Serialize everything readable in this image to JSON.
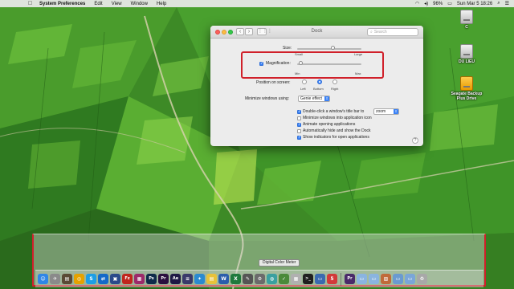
{
  "menubar": {
    "apple": "",
    "app_name": "System Preferences",
    "items": [
      "Edit",
      "View",
      "Window",
      "Help"
    ],
    "battery": "96%",
    "datetime": "Sun Mar 5  18:26"
  },
  "desktop": {
    "icons": [
      {
        "label": "C"
      },
      {
        "label": "DU LIEU"
      },
      {
        "label": "Seagate Backup Plus Drive"
      }
    ]
  },
  "window": {
    "title": "Dock",
    "search_placeholder": "Search",
    "size_label": "Size:",
    "size_small": "Small",
    "size_large": "Large",
    "size_value": 0.55,
    "magnification_label": "Magnification:",
    "magnification_checked": true,
    "mag_min": "Min",
    "mag_max": "Max",
    "magnification_value": 0.05,
    "position_label": "Position on screen:",
    "position_options": [
      "Left",
      "Bottom",
      "Right"
    ],
    "position_selected": "Bottom",
    "minimize_label": "Minimize windows using:",
    "minimize_value": "Genie effect",
    "doubleclick_label": "Double-click a window's title bar to",
    "doubleclick_value": "zoom",
    "doubleclick_checked": true,
    "minimize_into_icon": "Minimize windows into application icon",
    "minimize_into_icon_checked": false,
    "animate_label": "Animate opening applications",
    "animate_checked": true,
    "autohide_label": "Automatically hide and show the Dock",
    "autohide_checked": false,
    "indicators_label": "Show indicators for open applications",
    "indicators_checked": true,
    "help": "?"
  },
  "tooltip": "Digital Color Meter",
  "dock": {
    "apps": [
      {
        "name": "finder-icon",
        "glyph": "☺",
        "color": "#2f86e6"
      },
      {
        "name": "launchpad-icon",
        "glyph": "✈",
        "color": "#8a8a8a"
      },
      {
        "name": "photo-icon",
        "glyph": "▤",
        "color": "#5a4a36"
      },
      {
        "name": "chrome-icon",
        "glyph": "◎",
        "color": "#e5a200"
      },
      {
        "name": "skype-icon",
        "glyph": "S",
        "color": "#1d9ee6"
      },
      {
        "name": "teamviewer-icon",
        "glyph": "⇄",
        "color": "#1469c8"
      },
      {
        "name": "virtualbox-icon",
        "glyph": "▣",
        "color": "#2b4a8a"
      },
      {
        "name": "filezilla-icon",
        "glyph": "Fz",
        "color": "#c0261d"
      },
      {
        "name": "app-icon",
        "glyph": "▦",
        "color": "#9c2a6a"
      },
      {
        "name": "photoshop-icon",
        "glyph": "Ps",
        "color": "#0f2a4a"
      },
      {
        "name": "premiere-icon",
        "glyph": "Pr",
        "color": "#2a0f3f"
      },
      {
        "name": "after-effects-icon",
        "glyph": "Ae",
        "color": "#1f1845"
      },
      {
        "name": "app-icon",
        "glyph": "≡",
        "color": "#3a3a6a"
      },
      {
        "name": "safari-icon",
        "glyph": "✦",
        "color": "#2b8ad0"
      },
      {
        "name": "notes-icon",
        "glyph": "▤",
        "color": "#e8c23a"
      },
      {
        "name": "word-icon",
        "glyph": "W",
        "color": "#2b5dab"
      },
      {
        "name": "excel-icon",
        "glyph": "X",
        "color": "#1f7a3d"
      },
      {
        "name": "app-icon",
        "glyph": "✎",
        "color": "#555555"
      },
      {
        "name": "system-preferences-icon",
        "glyph": "⚙",
        "color": "#6b6b6b"
      },
      {
        "name": "app-icon",
        "glyph": "◍",
        "color": "#3aa0a0"
      },
      {
        "name": "app-icon",
        "glyph": "✓",
        "color": "#4a8a3a"
      },
      {
        "name": "calendar-icon",
        "glyph": "▦",
        "color": "#b0b0b0"
      },
      {
        "name": "terminal-icon",
        "glyph": ">_",
        "color": "#202020"
      },
      {
        "name": "app-icon",
        "glyph": "▭",
        "color": "#3a6ab0"
      },
      {
        "name": "calendar-date-icon",
        "glyph": "5",
        "color": "#d23a3a"
      }
    ],
    "docs": [
      {
        "name": "premiere-doc-icon",
        "glyph": "Pr",
        "color": "#4a2a6a"
      },
      {
        "name": "folder-icon",
        "glyph": "▭",
        "color": "#8ab4e0"
      },
      {
        "name": "folder-icon",
        "glyph": "▭",
        "color": "#8ab4e0"
      },
      {
        "name": "image-icon",
        "glyph": "▨",
        "color": "#c06a3a"
      },
      {
        "name": "folder-icon",
        "glyph": "▭",
        "color": "#6a9ad0"
      },
      {
        "name": "folder-icon",
        "glyph": "▭",
        "color": "#7aa6d8"
      },
      {
        "name": "trash-icon",
        "glyph": "♻",
        "color": "#a8a8a8"
      }
    ]
  }
}
